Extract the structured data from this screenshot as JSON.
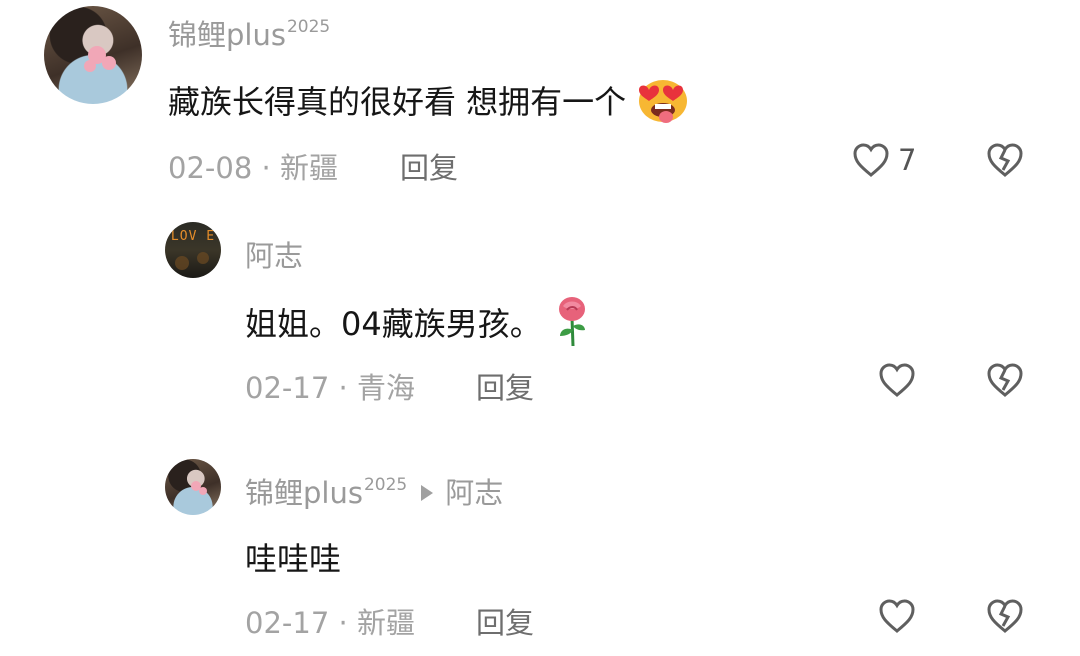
{
  "comments": [
    {
      "username": "锦鲤plus",
      "username_sup": "2025",
      "text": "藏族长得真的很好看  想拥有一个",
      "emoji": "star-struck-tongue-emoji",
      "date": "02-08",
      "location": "新疆",
      "reply_label": "回复",
      "like_count": "7"
    },
    {
      "username": "阿志",
      "text": "姐姐。04藏族男孩。",
      "emoji": "rose-emoji",
      "avatar_text": "LOV E",
      "date": "02-17",
      "location": "青海",
      "reply_label": "回复",
      "like_count": ""
    },
    {
      "username": "锦鲤plus",
      "username_sup": "2025",
      "reply_to": "阿志",
      "text": "哇哇哇",
      "date": "02-17",
      "location": "新疆",
      "reply_label": "回复",
      "like_count": ""
    }
  ],
  "separator": " · ",
  "colors": {
    "meta": "#a3a3a3",
    "text": "#161616",
    "icon": "#5f5f5f"
  }
}
